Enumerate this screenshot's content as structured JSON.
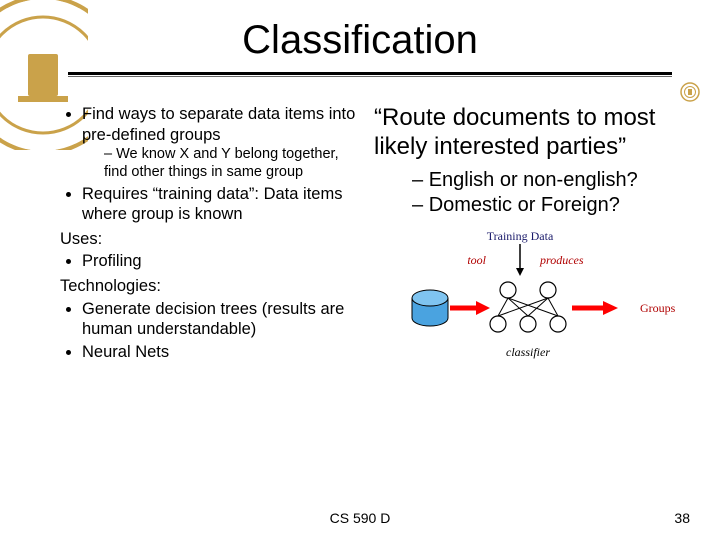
{
  "title": "Classification",
  "left": {
    "b1": "Find ways to separate data items into pre-defined groups",
    "b1_sub": "We know X and Y belong together, find other things in same group",
    "b2": "Requires “training data”:  Data items where group is known",
    "uses_label": "Uses:",
    "use1": "Profiling",
    "tech_label": "Technologies:",
    "tech1": "Generate decision trees (results are human understandable)",
    "tech2": "Neural Nets"
  },
  "right": {
    "quote": "“Route documents to most likely interested parties”",
    "q1": "English or non-english?",
    "q2": "Domestic or Foreign?"
  },
  "diagram": {
    "training": "Training Data",
    "tool": "tool",
    "produces": "produces",
    "groups": "Groups",
    "classifier": "classifier"
  },
  "footer": {
    "center": "CS 590 D",
    "page": "38"
  }
}
